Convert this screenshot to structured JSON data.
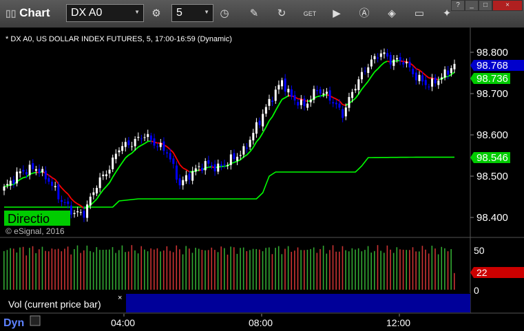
{
  "window": {
    "title": "Chart",
    "symbol": "DX A0",
    "interval": "5",
    "controls": [
      "?",
      "_",
      "□",
      "×"
    ]
  },
  "toolbar_icons": [
    "clock-icon",
    "pencil-icon",
    "refresh-icon",
    "get-icon",
    "play-icon",
    "alert-icon",
    "tag-icon",
    "comment-icon",
    "twitter-icon"
  ],
  "chart_header": "* DX A0, US DOLLAR INDEX FUTURES, 5, 17:00-16:59 (Dynamic)",
  "copyright": "© eSignal, 2016",
  "direction_label": "Directio",
  "vol_panel_label": "Vol (current price bar)",
  "vol_close": "×",
  "dyn_label": "Dyn",
  "colors": {
    "up_candle": "#ffffff",
    "down_candle": "#0000ff",
    "ema_fast_up": "#00ff00",
    "ema_fast_down": "#ff0000",
    "ema_slow": "#00ff00",
    "last_price_tag": "#0000cc",
    "fast_tag": "#00cc00",
    "slow_tag": "#00cc00",
    "vol_tag": "#cc0000",
    "vol_up": "#33aa33",
    "vol_down": "#cc3333"
  },
  "chart_data": {
    "type": "candlestick",
    "price_axis": {
      "ticks": [
        "98.800",
        "98.700",
        "98.600",
        "98.500",
        "98.400"
      ],
      "tick_values": [
        98.8,
        98.7,
        98.6,
        98.5,
        98.4
      ],
      "ylim": [
        98.37,
        98.86
      ]
    },
    "time_axis": {
      "ticks": [
        "04:00",
        "08:00",
        "12:00"
      ]
    },
    "last_price": "98.768",
    "fast_ma_value": "98.736",
    "slow_ma_value": "98.546",
    "volume_axis": {
      "ticks": [
        "50",
        "0"
      ],
      "ylim": [
        0,
        60
      ]
    },
    "last_volume": "22",
    "price_anchors": [
      [
        0,
        98.47
      ],
      [
        5,
        98.51
      ],
      [
        10,
        98.52
      ],
      [
        14,
        98.49
      ],
      [
        18,
        98.44
      ],
      [
        22,
        98.41
      ],
      [
        25,
        98.41
      ],
      [
        29,
        98.48
      ],
      [
        33,
        98.52
      ],
      [
        36,
        98.57
      ],
      [
        40,
        98.58
      ],
      [
        44,
        98.6
      ],
      [
        47,
        98.58
      ],
      [
        51,
        98.56
      ],
      [
        55,
        98.48
      ],
      [
        59,
        98.51
      ],
      [
        63,
        98.53
      ],
      [
        67,
        98.52
      ],
      [
        71,
        98.54
      ],
      [
        75,
        98.56
      ],
      [
        79,
        98.62
      ],
      [
        83,
        98.68
      ],
      [
        87,
        98.73
      ],
      [
        90,
        98.69
      ],
      [
        94,
        98.67
      ],
      [
        98,
        98.71
      ],
      [
        102,
        98.69
      ],
      [
        106,
        98.65
      ],
      [
        110,
        98.72
      ],
      [
        114,
        98.77
      ],
      [
        118,
        98.8
      ],
      [
        121,
        98.78
      ],
      [
        125,
        98.78
      ],
      [
        129,
        98.74
      ],
      [
        133,
        98.72
      ],
      [
        137,
        98.74
      ],
      [
        141,
        98.77
      ]
    ],
    "slow_ma_steps": [
      [
        0,
        98.425
      ],
      [
        34,
        98.425
      ],
      [
        36,
        98.44
      ],
      [
        42,
        98.445
      ],
      [
        79,
        98.445
      ],
      [
        81,
        98.46
      ],
      [
        83,
        98.5
      ],
      [
        85,
        98.51
      ],
      [
        110,
        98.51
      ],
      [
        112,
        98.525
      ],
      [
        114,
        98.545
      ],
      [
        130,
        98.546
      ],
      [
        141,
        98.546
      ]
    ]
  }
}
